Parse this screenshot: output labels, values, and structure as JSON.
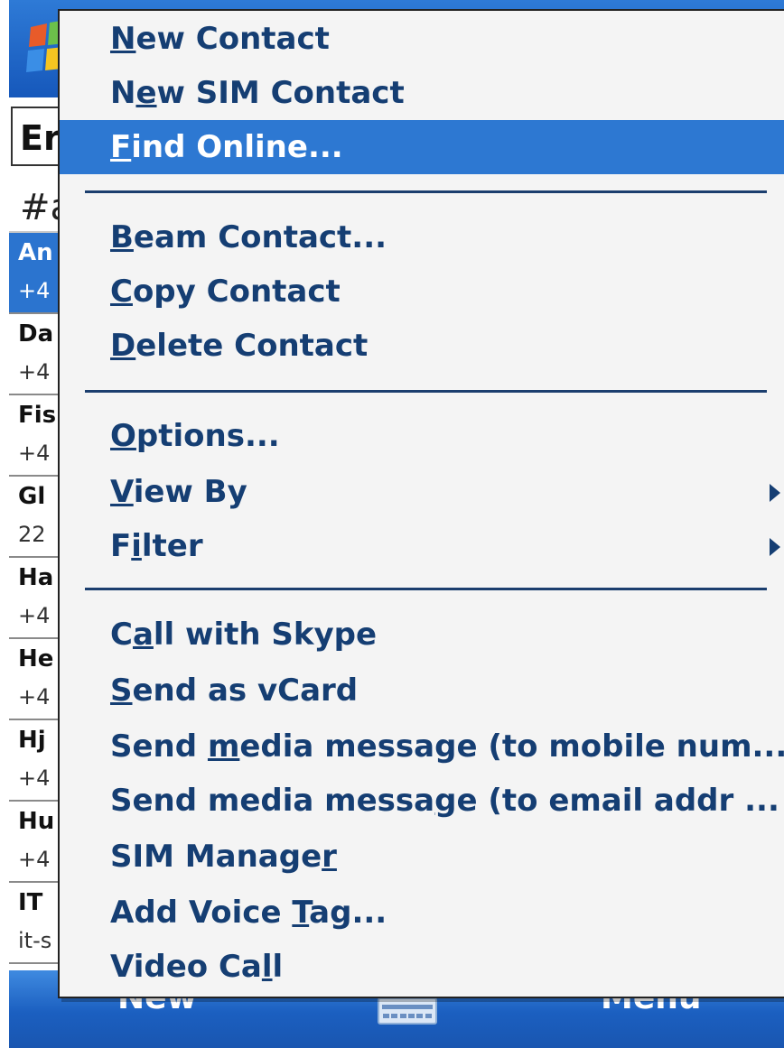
{
  "background": {
    "search_text": "Er",
    "alpha_text": "#a",
    "contacts": [
      {
        "name": "An",
        "phone": "+4",
        "selected": true
      },
      {
        "name": "Da",
        "phone": "+4",
        "selected": false
      },
      {
        "name": "Fis",
        "phone": "+4",
        "selected": false
      },
      {
        "name": "Gl",
        "phone": "22",
        "selected": false
      },
      {
        "name": "Ha",
        "phone": "+4",
        "selected": false
      },
      {
        "name": "He",
        "phone": "+4",
        "selected": false
      },
      {
        "name": "Hj",
        "phone": "+4",
        "selected": false
      },
      {
        "name": "Hu",
        "phone": "+4",
        "selected": false
      },
      {
        "name": "IT",
        "phone": "it-s",
        "selected": false
      }
    ]
  },
  "softkeys": {
    "left": "New",
    "right": "Menu",
    "keyboard_icon": "keyboard-icon"
  },
  "menu": {
    "items": [
      {
        "pre": "",
        "u": "N",
        "post": "ew Contact"
      },
      {
        "pre": "N",
        "u": "e",
        "post": "w SIM Contact"
      },
      {
        "pre": "",
        "u": "F",
        "post": "ind Online...",
        "highlighted": true
      },
      {
        "pre": "",
        "u": "B",
        "post": "eam Contact..."
      },
      {
        "pre": "",
        "u": "C",
        "post": "opy Contact"
      },
      {
        "pre": "",
        "u": "D",
        "post": "elete Contact"
      },
      {
        "pre": "",
        "u": "O",
        "post": "ptions..."
      },
      {
        "pre": "",
        "u": "V",
        "post": "iew By",
        "submenu": true
      },
      {
        "pre": "F",
        "u": "i",
        "post": "lter",
        "submenu": true
      },
      {
        "pre": "C",
        "u": "a",
        "post": "ll with Skype"
      },
      {
        "pre": "",
        "u": "S",
        "post": "end as vCard"
      },
      {
        "pre": "Send ",
        "u": "m",
        "post": "edia message (to mobile num..."
      },
      {
        "pre": "Send media messa",
        "u": "g",
        "post": "e (to email addr  ..."
      },
      {
        "pre": "SIM Manage",
        "u": "r",
        "post": ""
      },
      {
        "pre": "Add Voice ",
        "u": "T",
        "post": "ag..."
      },
      {
        "pre": "Video Ca",
        "u": "l",
        "post": "l"
      }
    ]
  },
  "colors": {
    "menu_text": "#153e73",
    "highlight": "#2d78d2",
    "titlebar": "#1f6ccb"
  }
}
